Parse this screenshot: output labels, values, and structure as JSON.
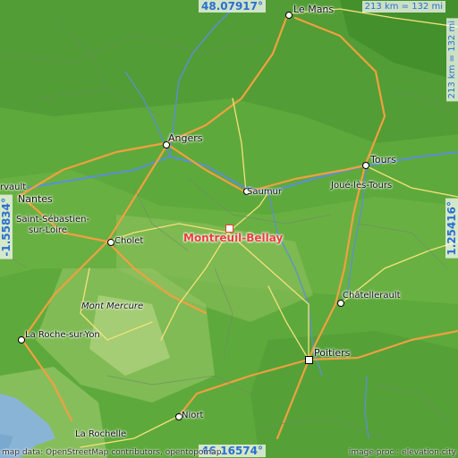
{
  "coords": {
    "top_lat": "48.07917°",
    "bottom_lat": "46.16574°",
    "left_lon": "-1.55834°",
    "right_lon": "1.25416°"
  },
  "scale": {
    "horizontal": "213 km = 132 mi",
    "vertical": "213 km = 132 mi"
  },
  "highlight": "Montreuil-Bellay",
  "cities": {
    "le_mans": "Le Mans",
    "angers": "Angers",
    "tours": "Tours",
    "joue": "Joué-lès-Tours",
    "saumur": "Saumur",
    "nantes": "Nantes",
    "saint_sebastien_1": "Saint-Sébastien-",
    "saint_sebastien_2": "sur-Loire",
    "cholet": "Cholet",
    "mont_mercure": "Mont Mercure",
    "roche_sur_yon": "La Roche-sur-Yon",
    "chatellerault": "Châtellerault",
    "poitiers": "Poitiers",
    "niort": "Niort",
    "la_rochelle": "La Rochelle",
    "rvault": "rvault"
  },
  "credits": {
    "left": "map data: OpenStreetMap contributors, opentopomap",
    "right": "image proc.: elevation.city"
  }
}
